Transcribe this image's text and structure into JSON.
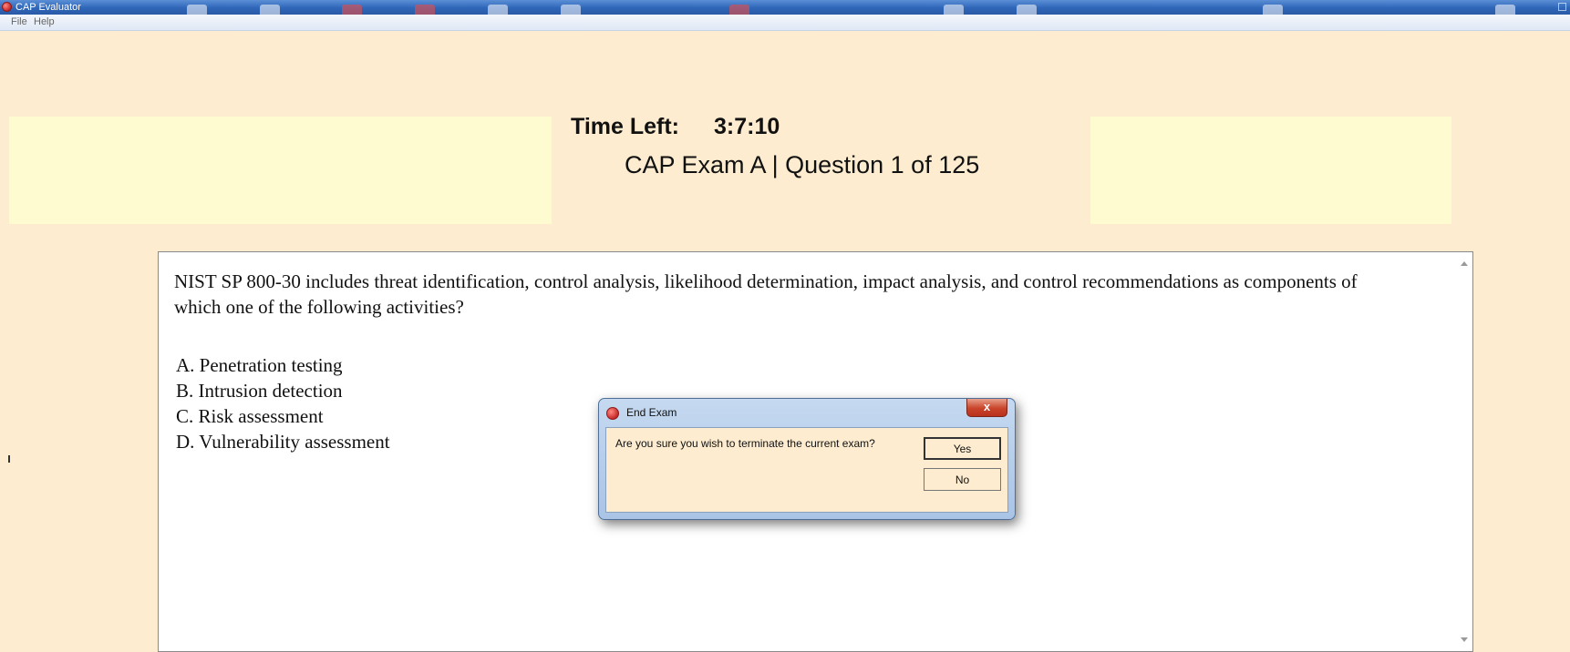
{
  "window": {
    "title": "CAP Evaluator",
    "app_icon": "app-logo-icon"
  },
  "menu": {
    "items": [
      {
        "label": "File"
      },
      {
        "label": "Help"
      }
    ]
  },
  "header": {
    "time_left_label": "Time Left:",
    "time_left_value": "3:7:10",
    "exam_info": "CAP Exam A | Question 1 of 125"
  },
  "question": {
    "text": "NIST SP 800-30 includes threat identification, control analysis, likelihood determination, impact analysis, and control recommendations as components of which one of the following activities?",
    "options": [
      "A.  Penetration testing",
      "B.  Intrusion detection",
      "C.  Risk assessment",
      "D.  Vulnerability assessment"
    ]
  },
  "dialog": {
    "title": "End Exam",
    "close_glyph": "x",
    "message": "Are you sure you wish to terminate the current exam?",
    "yes_label": "Yes",
    "no_label": "No"
  },
  "colors": {
    "background": "#fdeccf",
    "header_panel": "#fffbd0",
    "titlebar": "#2f66b8",
    "close_button": "#c9432a"
  }
}
